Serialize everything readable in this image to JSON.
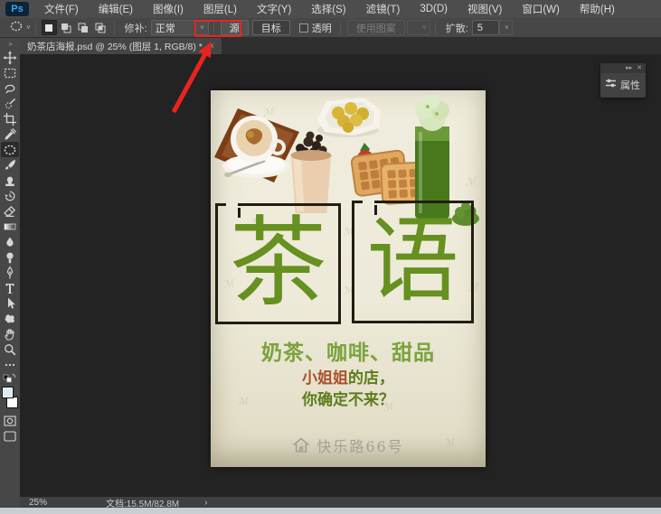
{
  "app": {
    "logo": "Ps"
  },
  "menubar": {
    "items": [
      "文件(F)",
      "编辑(E)",
      "图像(I)",
      "图层(L)",
      "文字(Y)",
      "选择(S)",
      "滤镜(T)",
      "3D(D)",
      "视图(V)",
      "窗口(W)",
      "帮助(H)"
    ]
  },
  "options_bar": {
    "preset_caret": "˅",
    "patch_label": "修补:",
    "patch_mode_value": "正常",
    "source_button": "源",
    "destination_button": "目标",
    "transparent_label": "透明",
    "use_pattern_button": "使用图案",
    "diffusion_label": "扩散:",
    "diffusion_value": "5",
    "caret": "˅"
  },
  "document_tab": {
    "title": "奶茶店海报.psd @ 25% (图层 1, RGB/8) *",
    "close": "×"
  },
  "toolbar": {
    "collapse": "»",
    "tools": [
      "move-tool",
      "rectangular-marquee-tool",
      "lasso-tool",
      "quick-selection-tool",
      "crop-tool",
      "eyedropper-tool",
      "patch-tool (active)",
      "brush-tool",
      "clone-stamp-tool",
      "history-brush-tool",
      "eraser-tool",
      "gradient-tool",
      "blur-tool",
      "dodge-tool",
      "pen-tool",
      "type-tool",
      "path-selection-tool",
      "custom-shape-tool",
      "hand-tool",
      "zoom-tool",
      "edit-toolbar-ellipsis",
      "foreground-background-swatches",
      "quick-mask-mode",
      "screen-mode"
    ]
  },
  "properties_panel": {
    "title": "属性",
    "collapse": "▸▸",
    "close": "✕"
  },
  "poster": {
    "char_left": "茶",
    "char_right": "语",
    "subtitle": "奶茶、咖啡、甜品",
    "line1_em": "小姐姐",
    "line1_rest": "的店，",
    "line2": "你确定不来？",
    "address": "快乐路66号",
    "watermark_glyph": "ℳ",
    "colors": {
      "title_green": "#66901f",
      "subtitle_green": "#7ba23c",
      "emphasis_red": "#a9512a",
      "address_gray": "#a3a193",
      "background_cream": "#edead9"
    }
  },
  "status_bar": {
    "zoom": "25%",
    "document_info": "文档:15.5M/82.8M",
    "chevron": "›"
  },
  "annotation": {
    "color": "#e8241f"
  }
}
